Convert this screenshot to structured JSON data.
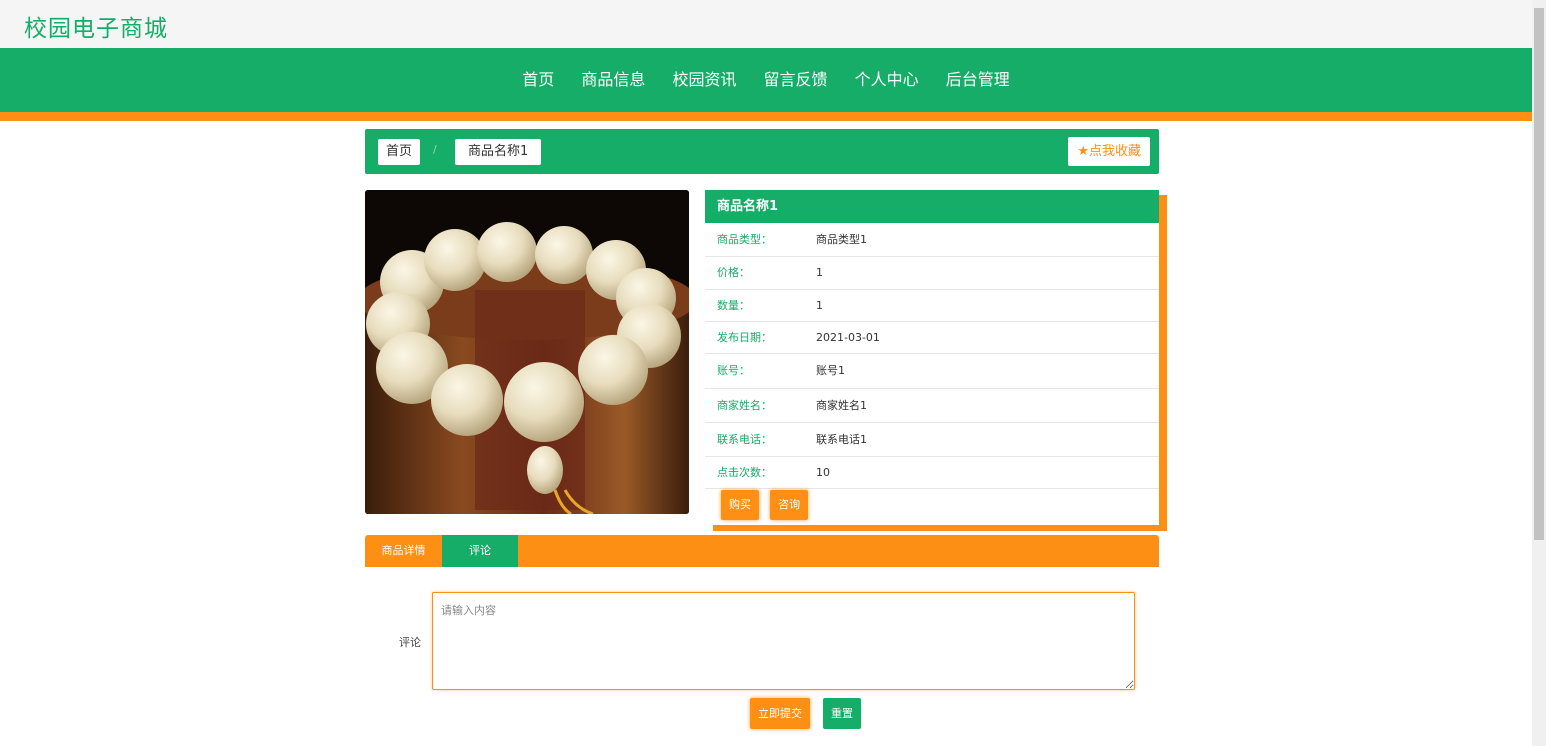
{
  "site": {
    "title": "校园电子商城"
  },
  "nav": {
    "items": [
      "首页",
      "商品信息",
      "校园资讯",
      "留言反馈",
      "个人中心",
      "后台管理"
    ]
  },
  "breadcrumb": {
    "home": "首页",
    "separator": "/",
    "current": "商品名称1"
  },
  "favorite": {
    "label": "点我收藏",
    "icon": "star-icon"
  },
  "product": {
    "name": "商品名称1",
    "image_alt": "bead-bracelet-photo",
    "fields": [
      {
        "label": "商品类型：",
        "value": "商品类型1"
      },
      {
        "label": "价格：",
        "value": "1"
      },
      {
        "label": "数量：",
        "value": "1"
      },
      {
        "label": "发布日期：",
        "value": "2021-03-01"
      },
      {
        "label": "账号：",
        "value": "账号1"
      },
      {
        "label": "商家姓名：",
        "value": "商家姓名1"
      },
      {
        "label": "联系电话：",
        "value": "联系电话1"
      },
      {
        "label": "点击次数：",
        "value": "10"
      }
    ],
    "buy_label": "购买",
    "consult_label": "咨询"
  },
  "tabs": {
    "detail": "商品详情",
    "comment": "评论",
    "active": "评论"
  },
  "comment_form": {
    "label": "评论",
    "placeholder": "请输入内容",
    "value": "",
    "submit_label": "立即提交",
    "reset_label": "重置"
  },
  "colors": {
    "green": "#16ad68",
    "orange": "#fd8f14"
  }
}
